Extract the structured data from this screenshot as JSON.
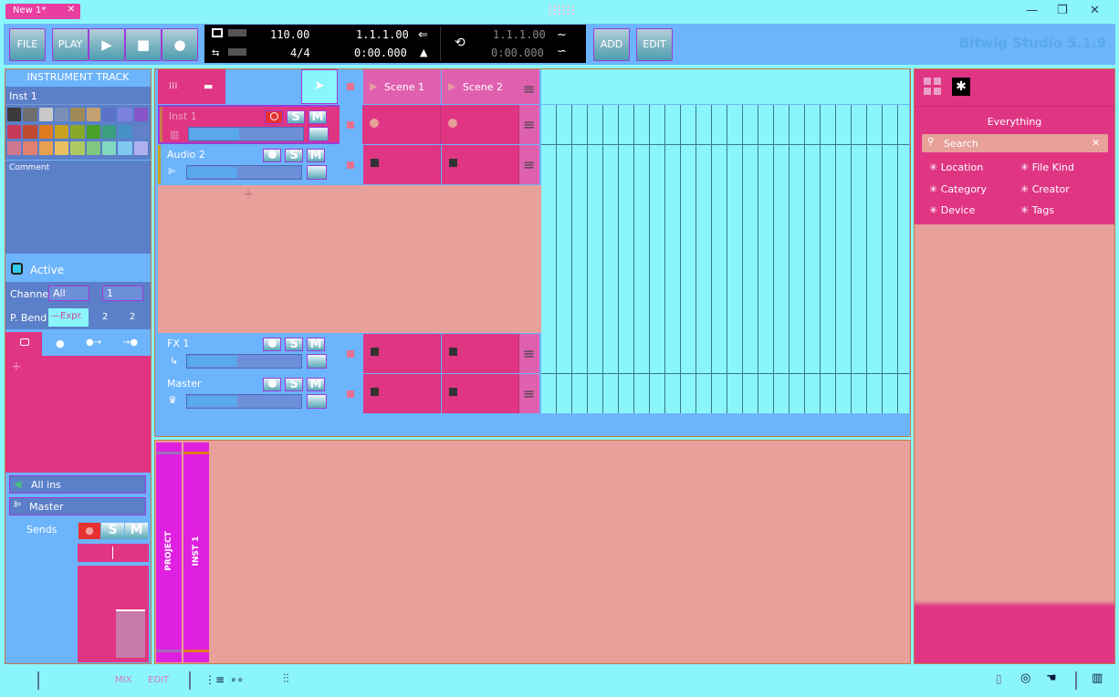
{
  "window": {
    "tab_title": "New 1*",
    "tab_close": "✕",
    "brand": "Bitwig Studio 5.1.9",
    "controls": [
      "—",
      "❐",
      "✕"
    ]
  },
  "toolbar": {
    "file": "FILE",
    "play": "PLAY",
    "play_icon": "▶",
    "stop_icon": "■",
    "record_icon": "●",
    "add": "ADD",
    "edit": "EDIT"
  },
  "transport": {
    "tempo": "110.00",
    "signature": "4/4",
    "position_bars": "1.1.1.00",
    "position_time": "0:00.000",
    "loop_start": "1.1.1.00",
    "loop_time": "0:00.000"
  },
  "inspector": {
    "header": "INSTRUMENT TRACK",
    "track_name": "Inst 1",
    "swatch_colors": [
      "#3b3b3b",
      "#6f6f6f",
      "#c9c9c9",
      "#7a8fb8",
      "#a08a55",
      "#c4a070",
      "#5b70c8",
      "#7b82e0",
      "#8a55c8",
      "#c83a5a",
      "#c04a30",
      "#e07a20",
      "#c8a020",
      "#88a828",
      "#48a028",
      "#3aa080",
      "#4890c8",
      "#6080c8",
      "#d07890",
      "#e08070",
      "#e8a050",
      "#e8c060",
      "#b0c860",
      "#80c880",
      "#80d8c0",
      "#80c8f0",
      "#b0b0f0"
    ],
    "comment_label": "Comment",
    "active_label": "Active",
    "channel_label": "Channel",
    "channel_value": "All",
    "channel_num": "1",
    "pbend_label": "P. Bend",
    "pbend_expr": "—Expr.",
    "pbend_v1": "2",
    "pbend_v2": "2",
    "all_ins": "All ins",
    "master": "Master",
    "sends": "Sends",
    "s": "S",
    "m": "M",
    "rec": "●"
  },
  "launcher": {
    "scenes": [
      "Scene 1",
      "Scene 2"
    ],
    "tracks": [
      {
        "name": "Inst 1",
        "s": "S",
        "m": "M"
      },
      {
        "name": "Audio 2",
        "s": "S",
        "m": "M"
      },
      {
        "name": "FX 1",
        "s": "S",
        "m": "M"
      },
      {
        "name": "Master",
        "s": "S",
        "m": "M"
      }
    ],
    "add_icon": "+"
  },
  "detail": {
    "project": "PROJECT",
    "inst1": "INST 1"
  },
  "browser": {
    "title": "Everything",
    "search_placeholder": "Search",
    "filters": [
      "Location",
      "File Kind",
      "Category",
      "Creator",
      "Device",
      "Tags"
    ]
  },
  "bottom": {
    "mix": "MIX",
    "edit": "EDIT"
  }
}
